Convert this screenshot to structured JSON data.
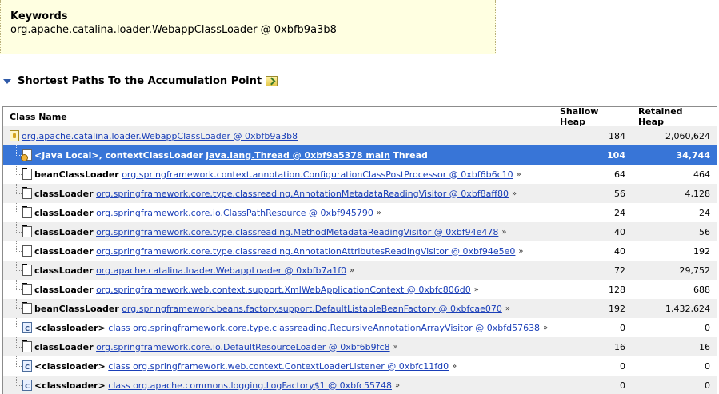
{
  "keywords": {
    "title": "Keywords",
    "value": "org.apache.catalina.loader.WebappClassLoader @ 0xbfb9a3b8"
  },
  "section": {
    "title": "Shortest Paths To the Accumulation Point"
  },
  "table": {
    "columns": [
      "Class Name",
      "Shallow Heap",
      "Retained Heap"
    ],
    "root": {
      "link": "org.apache.catalina.loader.WebappClassLoader @ 0xbfb9a3b8",
      "shallow": "184",
      "retained": "2,060,624"
    },
    "selected": {
      "prefix": "<Java Local>, contextClassLoader",
      "link": "java.lang.Thread @ 0xbf9a5378 main",
      "suffix": "Thread",
      "shallow": "104",
      "retained": "34,744"
    },
    "rows": [
      {
        "field": "beanClassLoader",
        "link": "org.springframework.context.annotation.ConfigurationClassPostProcessor @ 0xbf6b6c10",
        "more": "»",
        "shallow": "64",
        "retained": "464",
        "icon": "object-icon"
      },
      {
        "field": "classLoader",
        "link": "org.springframework.core.type.classreading.AnnotationMetadataReadingVisitor @ 0xbf8aff80",
        "more": "»",
        "shallow": "56",
        "retained": "4,128",
        "icon": "object-icon"
      },
      {
        "field": "classLoader",
        "link": "org.springframework.core.io.ClassPathResource @ 0xbf945790",
        "more": "»",
        "shallow": "24",
        "retained": "24",
        "icon": "object-icon"
      },
      {
        "field": "classLoader",
        "link": "org.springframework.core.type.classreading.MethodMetadataReadingVisitor @ 0xbf94e478",
        "more": "»",
        "shallow": "40",
        "retained": "56",
        "icon": "object-icon"
      },
      {
        "field": "classLoader",
        "link": "org.springframework.core.type.classreading.AnnotationAttributesReadingVisitor @ 0xbf94e5e0",
        "more": "»",
        "shallow": "40",
        "retained": "192",
        "icon": "object-icon"
      },
      {
        "field": "classLoader",
        "link": "org.apache.catalina.loader.WebappLoader @ 0xbfb7a1f0",
        "more": "»",
        "shallow": "72",
        "retained": "29,752",
        "icon": "object-icon"
      },
      {
        "field": "classLoader",
        "link": "org.springframework.web.context.support.XmlWebApplicationContext @ 0xbfc806d0",
        "more": "»",
        "shallow": "128",
        "retained": "688",
        "icon": "object-icon"
      },
      {
        "field": "beanClassLoader",
        "link": "org.springframework.beans.factory.support.DefaultListableBeanFactory @ 0xbfcae070",
        "more": "»",
        "shallow": "192",
        "retained": "1,432,624",
        "icon": "object-icon"
      },
      {
        "field": "<classloader>",
        "link": "class org.springframework.core.type.classreading.RecursiveAnnotationArrayVisitor @ 0xbfd57638",
        "more": "»",
        "shallow": "0",
        "retained": "0",
        "icon": "class-icon"
      },
      {
        "field": "classLoader",
        "link": "org.springframework.core.io.DefaultResourceLoader @ 0xbf6b9fc8",
        "more": "»",
        "shallow": "16",
        "retained": "16",
        "icon": "object-icon"
      },
      {
        "field": "<classloader>",
        "link": "class org.springframework.web.context.ContextLoaderListener @ 0xbfc11fd0",
        "more": "»",
        "shallow": "0",
        "retained": "0",
        "icon": "class-icon"
      },
      {
        "field": "<classloader>",
        "link": "class org.apache.commons.logging.LogFactory$1 @ 0xbfc55748",
        "more": "»",
        "shallow": "0",
        "retained": "0",
        "icon": "class-icon"
      }
    ]
  }
}
